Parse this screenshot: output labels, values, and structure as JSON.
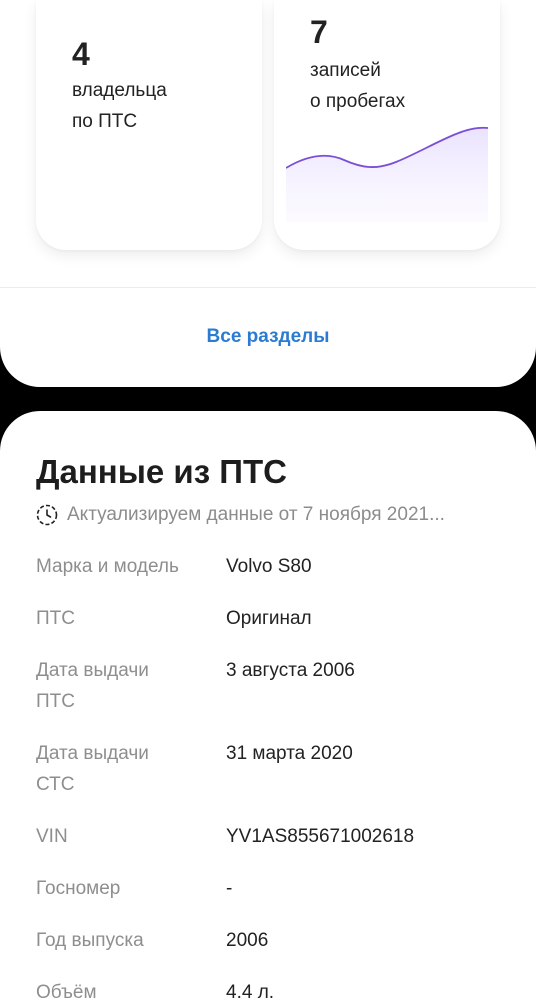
{
  "stats": {
    "owners": {
      "number": "4",
      "line1": "владельца",
      "line2": "по ПТС"
    },
    "mileage": {
      "number": "7",
      "line1": "записей",
      "line2": "о пробегах"
    }
  },
  "all_sections_link": "Все разделы",
  "pts": {
    "title": "Данные из ПТС",
    "update_text": "Актуализируем данные от 7 ноября 2021...",
    "rows": [
      {
        "label_lines": [
          "Марка и модель"
        ],
        "value": "Volvo S80"
      },
      {
        "label_lines": [
          "ПТС"
        ],
        "value": "Оригинал"
      },
      {
        "label_lines": [
          "Дата выдачи",
          "ПТС"
        ],
        "value": "3 августа 2006"
      },
      {
        "label_lines": [
          "Дата выдачи",
          "СТС"
        ],
        "value": "31 марта 2020"
      },
      {
        "label_lines": [
          "VIN"
        ],
        "value": "YV1AS855671002618"
      },
      {
        "label_lines": [
          "Госномер"
        ],
        "value": "-"
      },
      {
        "label_lines": [
          "Год выпуска"
        ],
        "value": "2006"
      },
      {
        "label_lines": [
          "Объём"
        ],
        "value": "4.4 л."
      }
    ]
  },
  "colors": {
    "accent_link": "#2b7bd3",
    "sparkline": "#7a4fd6",
    "sparkline_fill": "#efe9ff"
  },
  "icons": {
    "update": "clock-dashed-icon"
  }
}
